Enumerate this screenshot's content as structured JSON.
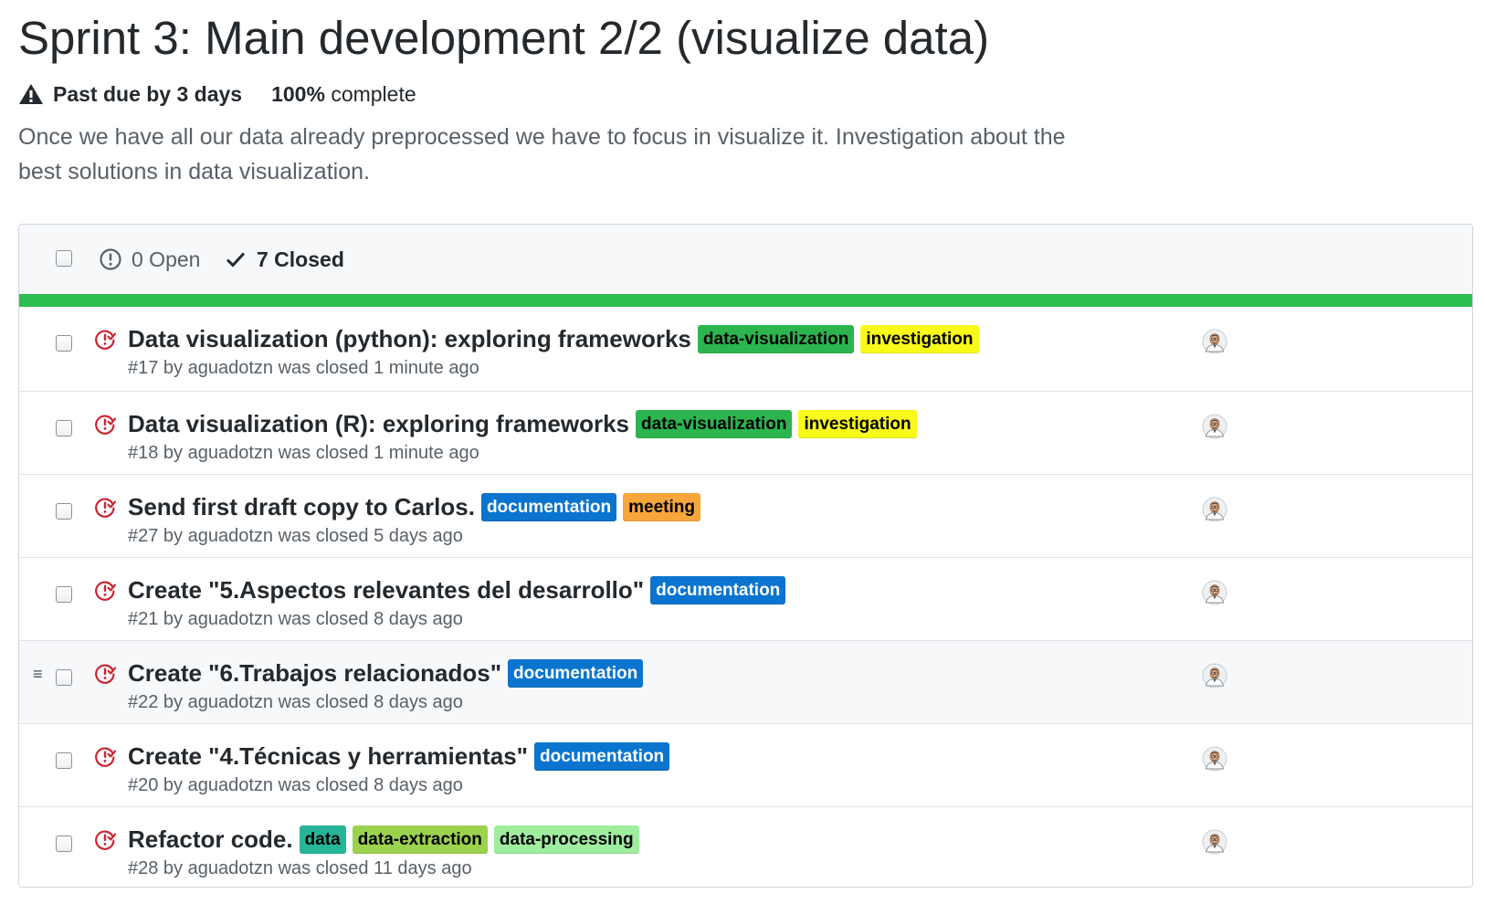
{
  "milestone": {
    "title": "Sprint 3: Main development 2/2 (visualize data)",
    "due_status": "Past due by 3 days",
    "percent": "100%",
    "percent_suffix": "complete",
    "description": "Once we have all our data already preprocessed we have to focus in visualize it. Investigation about the best solutions in data visualization."
  },
  "icons": {
    "warning": "alert-icon",
    "open": "issue-opened-icon",
    "closed_tab": "check-icon",
    "issue_closed": "issue-closed-icon",
    "drag": "drag-handle-icon",
    "avatar": "user-avatar"
  },
  "tabs": {
    "open_label": "0 Open",
    "closed_label": "7 Closed"
  },
  "progress": {
    "completed_fraction": 1.0,
    "color": "#2cbe4e"
  },
  "issues": [
    {
      "title": "Data visualization (python): exploring frameworks",
      "meta": "#17 by aguadotzn was closed 1 minute ago",
      "labels": [
        {
          "name": "data-visualization",
          "bg": "#2cb54e",
          "fg": "#000000"
        },
        {
          "name": "investigation",
          "bg": "#f9f91a",
          "fg": "#000000"
        }
      ]
    },
    {
      "title": "Data visualization (R): exploring frameworks",
      "meta": "#18 by aguadotzn was closed 1 minute ago",
      "labels": [
        {
          "name": "data-visualization",
          "bg": "#2cb54e",
          "fg": "#000000"
        },
        {
          "name": "investigation",
          "bg": "#f9f91a",
          "fg": "#000000"
        }
      ]
    },
    {
      "title": "Send first draft copy to Carlos.",
      "meta": "#27 by aguadotzn was closed 5 days ago",
      "labels": [
        {
          "name": "documentation",
          "bg": "#0a74ce",
          "fg": "#ffffff"
        },
        {
          "name": "meeting",
          "bg": "#f7a63b",
          "fg": "#000000"
        }
      ]
    },
    {
      "title": "Create \"5.Aspectos relevantes del desarrollo\"",
      "meta": "#21 by aguadotzn was closed 8 days ago",
      "labels": [
        {
          "name": "documentation",
          "bg": "#0a74ce",
          "fg": "#ffffff"
        }
      ]
    },
    {
      "title": "Create \"6.Trabajos relacionados\"",
      "meta": "#22 by aguadotzn was closed 8 days ago",
      "hovered": true,
      "labels": [
        {
          "name": "documentation",
          "bg": "#0a74ce",
          "fg": "#ffffff"
        }
      ]
    },
    {
      "title": "Create \"4.Técnicas y herramientas\"",
      "meta": "#20 by aguadotzn was closed 8 days ago",
      "labels": [
        {
          "name": "documentation",
          "bg": "#0a74ce",
          "fg": "#ffffff"
        }
      ]
    },
    {
      "title": "Refactor code.",
      "meta": "#28 by aguadotzn was closed 11 days ago",
      "labels": [
        {
          "name": "data",
          "bg": "#27b59a",
          "fg": "#000000"
        },
        {
          "name": "data-extraction",
          "bg": "#9bd24e",
          "fg": "#000000"
        },
        {
          "name": "data-processing",
          "bg": "#9fee9f",
          "fg": "#000000"
        }
      ]
    }
  ]
}
